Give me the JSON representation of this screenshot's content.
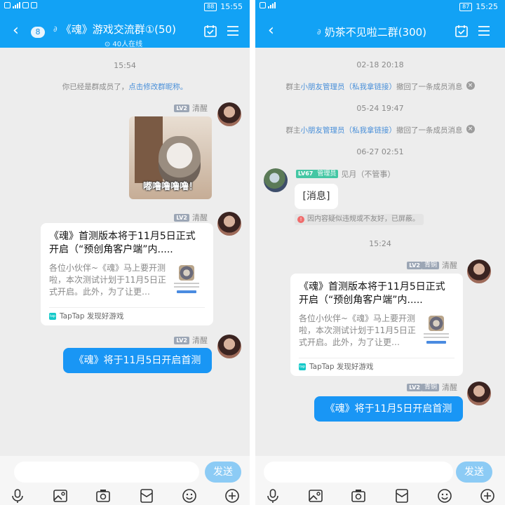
{
  "left": {
    "status": {
      "time": "15:55",
      "battery": "88"
    },
    "header": {
      "back_icon": "chevron-left-icon",
      "unread": "8",
      "title": "《魂》游戏交流群①(50)",
      "online": "⊙ 40人在线"
    },
    "timestamp": "15:54",
    "system": {
      "prefix": "你已经是群成员了，",
      "link": "点击修改群昵称。"
    },
    "messages": [
      {
        "level": "LV2",
        "sender": "清醒",
        "sticker_caption": "嘟噜噜噜噜！"
      },
      {
        "level": "LV2",
        "sender": "清醒",
        "card": {
          "title": "《魂》首测版本将于11月5日正式开启（“预创角客户端”内.....",
          "desc": "各位小伙伴~《魂》马上要开测啦，本次测试计划于11月5日正式开启。此外，为了让更…",
          "source": "TapTap 发现好游戏"
        }
      },
      {
        "level": "LV2",
        "sender": "清醒",
        "text": "《魂》将于11月5日开启首测"
      }
    ],
    "send_label": "发送"
  },
  "right": {
    "status": {
      "time": "15:25",
      "battery": "87"
    },
    "header": {
      "back_icon": "chevron-left-icon",
      "title": "奶茶不见啦二群(300)"
    },
    "events": [
      {
        "time": "02-18 20:18",
        "prefix": "群主",
        "link": "小朋友管理员（私我拿链接）",
        "suffix": "撤回了一条成员消息"
      },
      {
        "time": "05-24 19:47",
        "prefix": "群主",
        "link": "小朋友管理员（私我拿链接）",
        "suffix": "撤回了一条成员消息"
      }
    ],
    "time3": "06-27 02:51",
    "admin_msg": {
      "level": "LV67",
      "role": "管理员",
      "sender": "见月（不管事）",
      "text": "[消息]",
      "blocked": "因内容疑似违规或不友好，已屏蔽。"
    },
    "time4": "15:24",
    "messages": [
      {
        "level": "LV2",
        "rank": "青铜",
        "sender": "清醒",
        "card": {
          "title": "《魂》首测版本将于11月5日正式开启（“预创角客户端”内.....",
          "desc": "各位小伙伴~《魂》马上要开测啦，本次测试计划于11月5日正式开启。此外，为了让更…",
          "source": "TapTap 发现好游戏"
        }
      },
      {
        "level": "LV2",
        "rank": "青铜",
        "sender": "清醒",
        "text": "《魂》将于11月5日开启首测"
      }
    ],
    "send_label": "发送"
  },
  "toolbar_icons": [
    "microphone-icon",
    "image-icon",
    "camera-icon",
    "red-packet-icon",
    "emoji-icon",
    "plus-icon"
  ]
}
